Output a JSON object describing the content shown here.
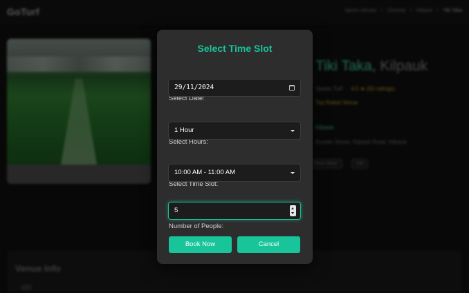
{
  "app": {
    "logo": "GoTurf",
    "breadcrumb": [
      "Sports Venues",
      "Chennai",
      "Kilpauk",
      "Tiki Taka"
    ]
  },
  "venue": {
    "name": "Tiki Taka,",
    "city": "Kilpauk",
    "line1": "Sports Turf",
    "rating": "4.5 ★ (50 ratings)",
    "line2": "Top Rated Venue",
    "line3": "Kilpauk",
    "address": "Bunder Street, Kilpauk Road, Kilpauk",
    "chips": [
      "Share Venue",
      "Call"
    ]
  },
  "venue_info": {
    "title": "Venue Info"
  },
  "modal": {
    "title": "Select Time Slot",
    "date_label": "Select Date:",
    "date_value": "29/11/2024",
    "hours_label": "Select Hours:",
    "hours_value": "1 Hour",
    "slot_label": "Select Time Slot:",
    "slot_value": "10:00 AM - 11:00 AM",
    "people_label": "Number of People:",
    "people_value": "5",
    "book_label": "Book Now",
    "cancel_label": "Cancel"
  },
  "colors": {
    "accent": "#18c49a",
    "modal_bg": "#2d2d2d",
    "field_bg": "#1c1c1c"
  }
}
